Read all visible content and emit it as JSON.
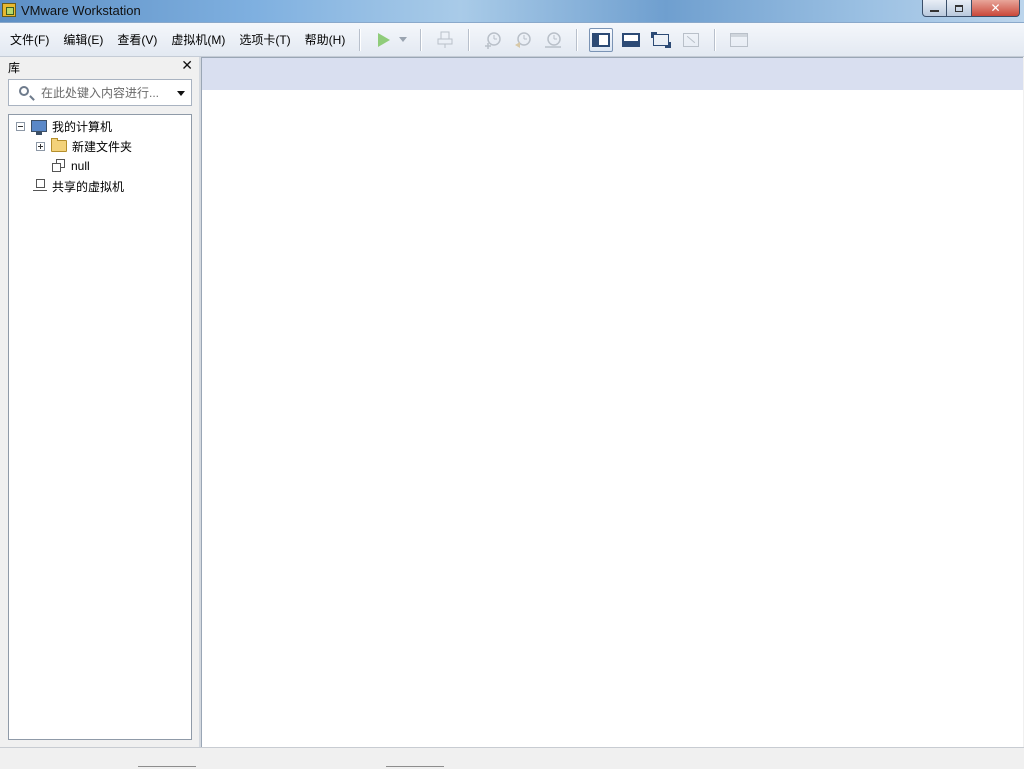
{
  "window": {
    "title": "VMware Workstation"
  },
  "menu": {
    "items": [
      {
        "label": "文件(F)"
      },
      {
        "label": "编辑(E)"
      },
      {
        "label": "查看(V)"
      },
      {
        "label": "虚拟机(M)"
      },
      {
        "label": "选项卡(T)"
      },
      {
        "label": "帮助(H)"
      }
    ]
  },
  "toolbar": {
    "icons": [
      "power-on-icon",
      "power-dropdown-icon",
      "send-ctrl-alt-del-icon",
      "snapshot-take-icon",
      "snapshot-revert-icon",
      "snapshot-manager-icon",
      "show-library-icon",
      "show-thumbnail-bar-icon",
      "full-screen-icon",
      "unity-icon",
      "console-view-icon"
    ]
  },
  "library": {
    "title": "库",
    "close_symbol": "✕",
    "search": {
      "placeholder": "在此处键入内容进行..."
    },
    "tree": [
      {
        "label": "我的计算机",
        "icon": "computer-icon",
        "expanded": true
      },
      {
        "label": "新建文件夹",
        "icon": "folder-icon",
        "expanded": false
      },
      {
        "label": "null",
        "icon": "vm-icon"
      },
      {
        "label": "共享的虚拟机",
        "icon": "shared-vms-icon"
      }
    ]
  },
  "colors": {
    "title_bar": "#7fb0e0",
    "tab_strip": "#d9dff0",
    "close_button": "#c9473a"
  }
}
